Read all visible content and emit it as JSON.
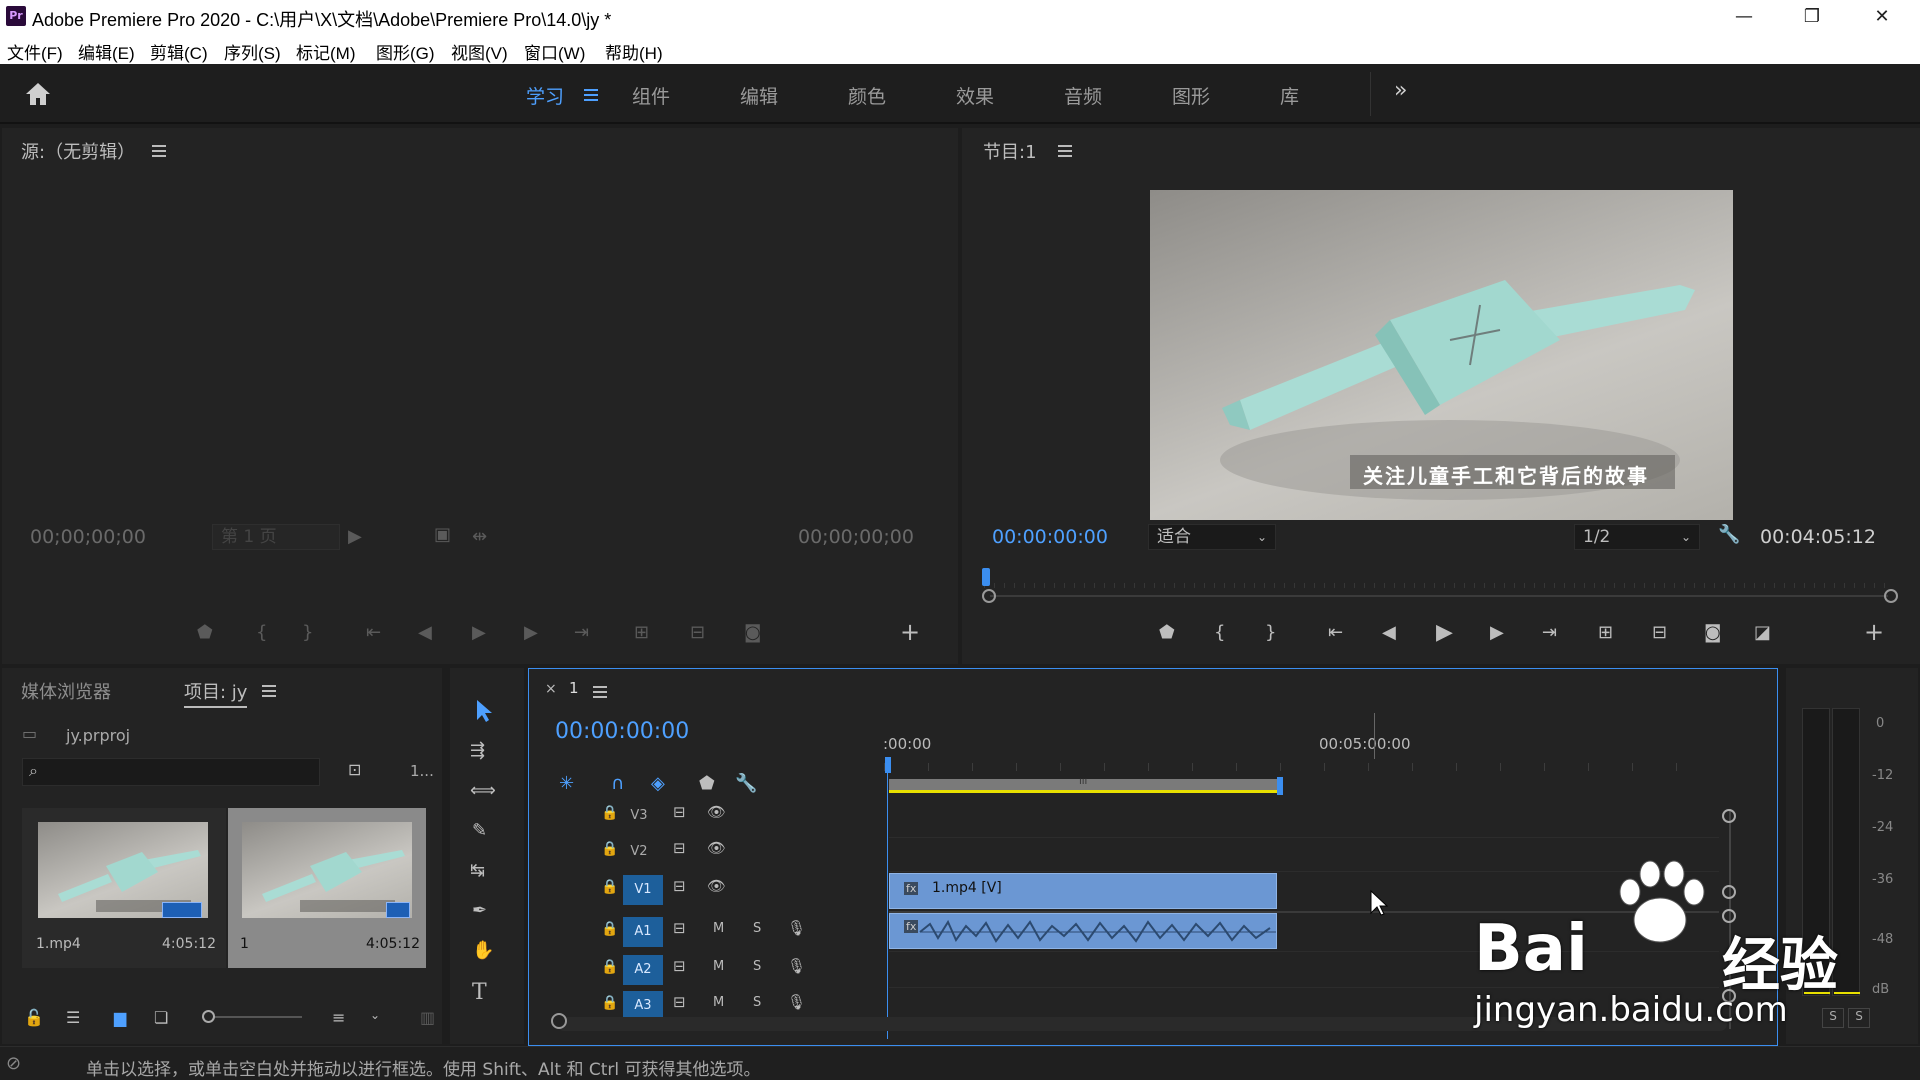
{
  "app": {
    "title": "Adobe Premiere Pro 2020 - C:\\用户\\X\\文档\\Adobe\\Premiere Pro\\14.0\\jy *",
    "logo": "Pr"
  },
  "window_controls": {
    "minimize": "—",
    "restore": "❐",
    "close": "✕"
  },
  "menu": [
    "文件(F)",
    "编辑(E)",
    "剪辑(C)",
    "序列(S)",
    "标记(M)",
    "图形(G)",
    "视图(V)",
    "窗口(W)",
    "帮助(H)"
  ],
  "workspaces": {
    "items": [
      "学习",
      "组件",
      "编辑",
      "颜色",
      "效果",
      "音频",
      "图形",
      "库"
    ],
    "active": "学习",
    "more": "»"
  },
  "source": {
    "title": "源:（无剪辑）",
    "tc_left": "00;00;00;00",
    "page_select": "第 1 页",
    "tc_right": "00;00;00;00"
  },
  "program": {
    "title": "节目:1",
    "timecode": "00:00:00:00",
    "fit_select": "适合",
    "resolution_select": "1/2",
    "duration": "00:04:05:12",
    "subtitle": "关注儿童手工和它背后的故事"
  },
  "project": {
    "tab_media": "媒体浏览器",
    "tab_project": "项目: jy",
    "file_name": "jy.prproj",
    "count": "1...",
    "items": [
      {
        "name": "1.mp4",
        "duration": "4:05:12"
      },
      {
        "name": "1",
        "duration": "4:05:12"
      }
    ]
  },
  "timeline": {
    "tab": "1",
    "timecode": "00:00:00:00",
    "ruler": [
      ":00:00",
      "00:05:00:00"
    ],
    "video_tracks": [
      "V3",
      "V2",
      "V1"
    ],
    "audio_tracks": [
      "A1",
      "A2",
      "A3"
    ],
    "m_label": "M",
    "s_label": "S",
    "clip_video": "1.mp4 [V]",
    "fx": "fx"
  },
  "meter": {
    "scale": [
      "0",
      "-12",
      "-24",
      "-36",
      "-48",
      "dB"
    ],
    "solo": [
      "S",
      "S"
    ]
  },
  "status": {
    "text": "单击以选择，或单击空白处并拖动以进行框选。使用 Shift、Alt 和 Ctrl 可获得其他选项。"
  },
  "watermark": {
    "brand": "Bai",
    "brand2": "经验",
    "url": "jingyan.baidu.com"
  },
  "colors": {
    "accent": "#4ea0ff",
    "clip_blue": "#6b97d3",
    "track_on": "#1d5f9b",
    "work_area_yellow": "#e8e000"
  }
}
